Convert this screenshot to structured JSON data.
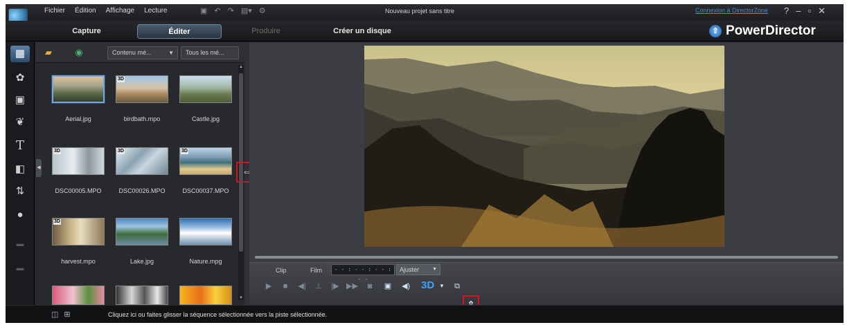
{
  "titlebar": {
    "menu": [
      "Fichier",
      "Édition",
      "Affichage",
      "Lecture"
    ],
    "window_title": "Nouveau projet sans titre",
    "connect_link": "Connexion à DirectorZone",
    "controls": [
      "?",
      "–",
      "▫",
      "✕"
    ]
  },
  "modes": {
    "capture": "Capture",
    "edit": "Éditer",
    "produce": "Produire",
    "disc": "Créer un disque",
    "active": "edit"
  },
  "brand": {
    "name": "PowerDirector"
  },
  "library": {
    "filter_label": "Contenu mé...",
    "sort_label": "Tous les mé...",
    "items": [
      {
        "name": "Aerial.jpg",
        "is3d": false,
        "selected": true
      },
      {
        "name": "birdbath.mpo",
        "is3d": true,
        "selected": false
      },
      {
        "name": "Castle.jpg",
        "is3d": false,
        "selected": false
      },
      {
        "name": "DSC00005.MPO",
        "is3d": true,
        "selected": false
      },
      {
        "name": "DSC00026.MPO",
        "is3d": true,
        "selected": false
      },
      {
        "name": "DSC00037.MPO",
        "is3d": true,
        "selected": false
      },
      {
        "name": "harvest.mpo",
        "is3d": true,
        "selected": false
      },
      {
        "name": "Lake.jpg",
        "is3d": false,
        "selected": false
      },
      {
        "name": "Nature.mpg",
        "is3d": false,
        "selected": false
      }
    ],
    "badge_3d": "3D"
  },
  "transport": {
    "clip_label": "Clip",
    "film_label": "Film",
    "timecode": "- - : - - : - - : - -",
    "fit_label": "Ajuster",
    "three_d_label": "3D"
  },
  "status": {
    "message": "Cliquez ici ou faites glisser la séquence sélectionnée vers la piste sélectionnée."
  }
}
